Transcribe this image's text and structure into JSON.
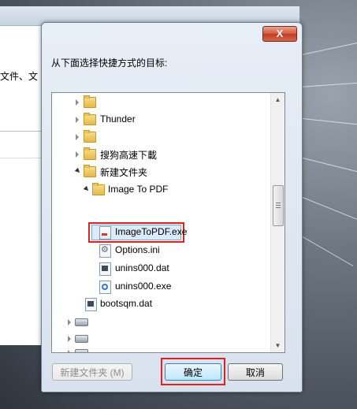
{
  "background_window": {
    "text": "文件、文"
  },
  "dialog": {
    "close_glyph": "X",
    "prompt": "从下面选择快捷方式的目标:",
    "tree": {
      "items": [
        {
          "label": "",
          "type": "folder",
          "expander": "closed"
        },
        {
          "label": "Thunder",
          "type": "folder",
          "expander": "closed"
        },
        {
          "label": "",
          "type": "folder",
          "expander": "closed"
        },
        {
          "label": "搜狗高速下載",
          "type": "folder",
          "expander": "closed"
        },
        {
          "label": "新建文件夹",
          "type": "folder",
          "expander": "open"
        },
        {
          "label": "Image To PDF",
          "type": "folder",
          "expander": "open"
        },
        {
          "label": "ImageToPDF.exe",
          "type": "exe",
          "selected": true
        },
        {
          "label": "Options.ini",
          "type": "ini"
        },
        {
          "label": "unins000.dat",
          "type": "dat"
        },
        {
          "label": "unins000.exe",
          "type": "uninstall-exe"
        },
        {
          "label": "bootsqm.dat",
          "type": "dat"
        },
        {
          "label": "",
          "type": "drive",
          "expander": "closed"
        },
        {
          "label": "",
          "type": "drive",
          "expander": "closed"
        },
        {
          "label": "",
          "type": "drive",
          "expander": "closed"
        }
      ]
    },
    "buttons": {
      "new_folder": "新建文件夹 (M)",
      "ok": "确定",
      "cancel": "取消"
    }
  }
}
